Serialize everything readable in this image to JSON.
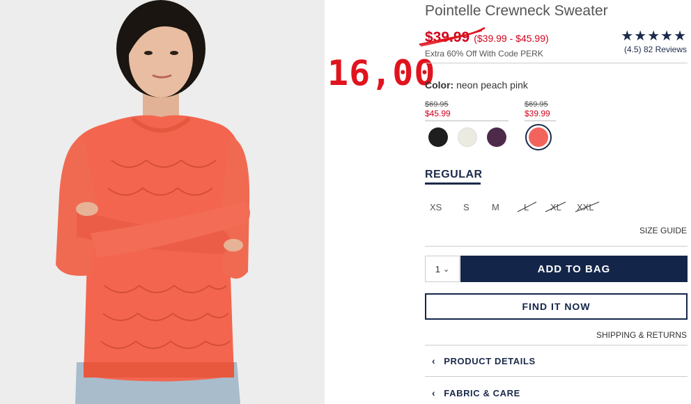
{
  "annotation": {
    "text": "16,00"
  },
  "product": {
    "title": "Pointelle Crewneck Sweater",
    "sale_price": "$39.99",
    "price_range": "($39.99 - $45.99)",
    "promo": "Extra 60% Off With Code PERK",
    "stars": "★★★★★",
    "reviews": "(4.5) 82 Reviews",
    "rating_value": 4.5
  },
  "color": {
    "label": "Color:",
    "value": "neon peach pink"
  },
  "price_groups": [
    {
      "was": "$69.95",
      "now": "$45.99"
    },
    {
      "was": "$69.95",
      "now": "$39.99"
    }
  ],
  "swatches": [
    {
      "name": "black",
      "color": "#1e1e1e"
    },
    {
      "name": "ivory",
      "color": "#ecebe2"
    },
    {
      "name": "plum",
      "color": "#4e2a4a"
    },
    {
      "name": "neon peach pink",
      "color": "#f2645b",
      "selected": true
    }
  ],
  "fit": {
    "label": "REGULAR"
  },
  "sizes": [
    {
      "label": "XS",
      "available": true
    },
    {
      "label": "S",
      "available": true
    },
    {
      "label": "M",
      "available": true
    },
    {
      "label": "L",
      "available": false
    },
    {
      "label": "XL",
      "available": false
    },
    {
      "label": "XXL",
      "available": false
    }
  ],
  "links": {
    "size_guide": "SIZE GUIDE",
    "shipping": "SHIPPING & RETURNS"
  },
  "qty": {
    "value": "1",
    "chevron": "⌄"
  },
  "buttons": {
    "add_to_bag": "ADD TO BAG",
    "find_it_now": "FIND IT NOW"
  },
  "accordion": [
    {
      "label": "PRODUCT DETAILS",
      "chevron": "‹"
    },
    {
      "label": "FABRIC & CARE",
      "chevron": "‹"
    }
  ],
  "colors": {
    "navy": "#14254a",
    "sale_red": "#d0021b",
    "annotation_red": "#e0141e"
  }
}
